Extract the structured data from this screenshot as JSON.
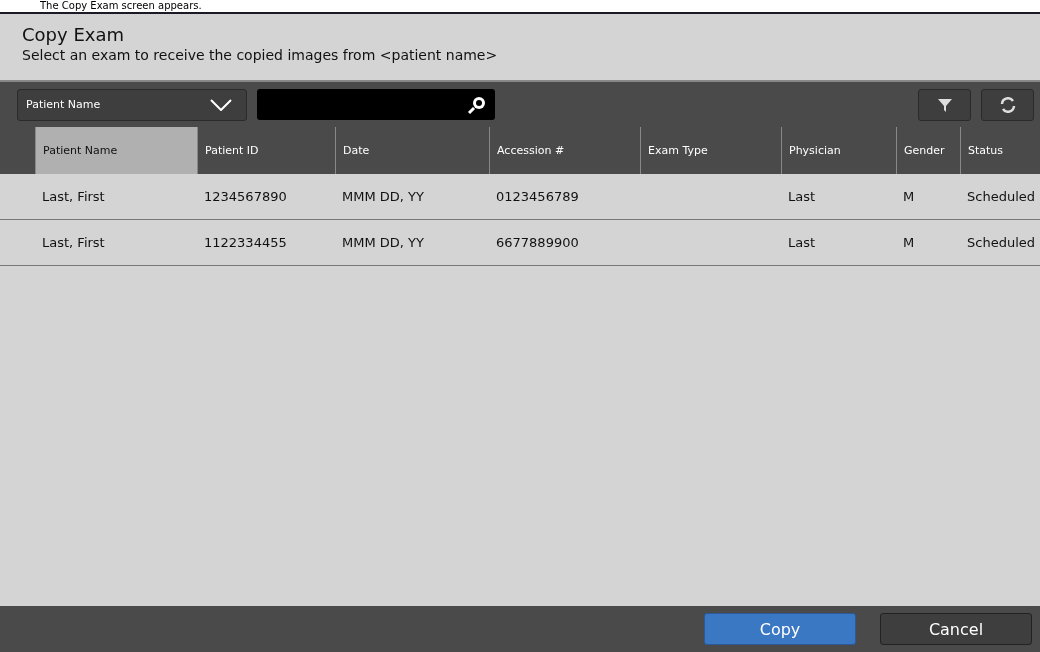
{
  "caption": "The Copy Exam screen appears.",
  "dialog": {
    "title": "Copy Exam",
    "subtitle": "Select an exam to receive the copied images from <patient name>"
  },
  "toolbar": {
    "search_by": "Patient Name"
  },
  "table": {
    "columns": [
      {
        "label": "Patient Name",
        "selected": true
      },
      {
        "label": "Patient ID",
        "selected": false
      },
      {
        "label": "Date",
        "selected": false
      },
      {
        "label": "Accession #",
        "selected": false
      },
      {
        "label": "Exam Type",
        "selected": false
      },
      {
        "label": "Physician",
        "selected": false
      },
      {
        "label": "Gender",
        "selected": false
      },
      {
        "label": "Status",
        "selected": false
      }
    ],
    "rows": [
      {
        "cells": [
          "Last, First",
          "1234567890",
          "MMM DD, YY",
          "0123456789",
          null,
          "Last",
          "M",
          "Scheduled"
        ]
      },
      {
        "cells": [
          "Last, First",
          "1122334455",
          "MMM DD, YY",
          "6677889900",
          null,
          "Last",
          "M",
          "Scheduled"
        ]
      }
    ]
  },
  "buttons": [
    {
      "label": "Copy",
      "kind": "primary"
    },
    {
      "label": "Cancel",
      "kind": "secondary"
    }
  ]
}
